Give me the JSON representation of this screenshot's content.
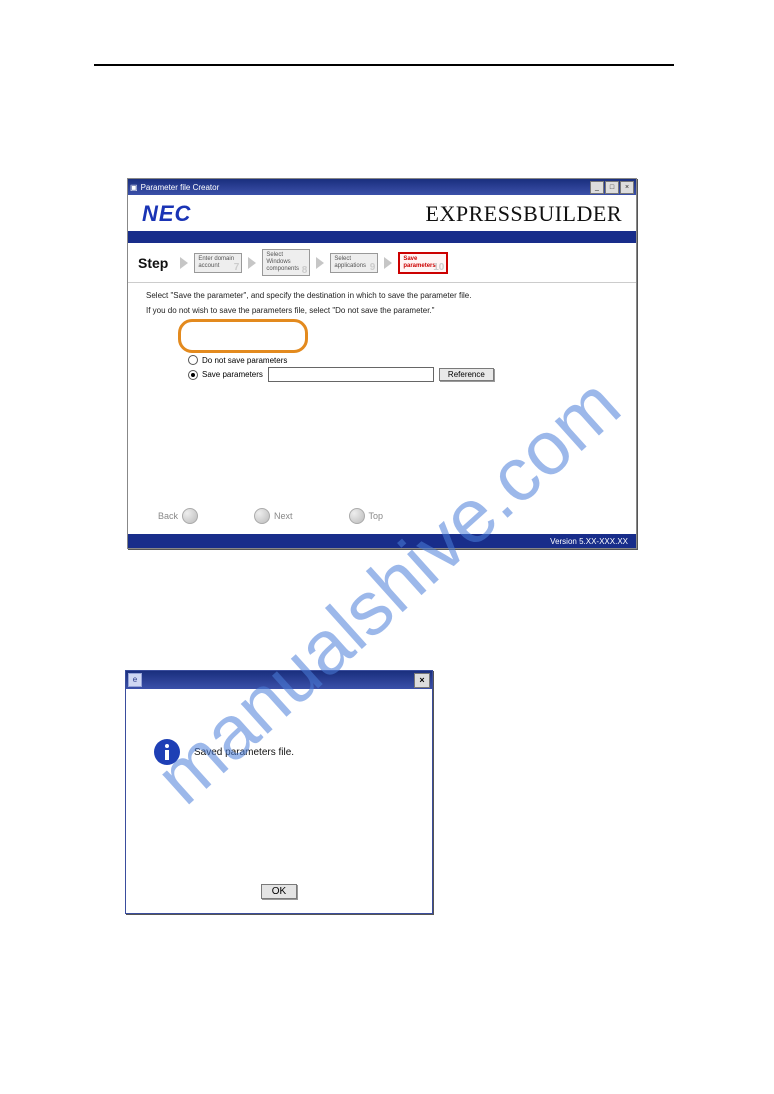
{
  "watermark_text": "manualshive.com",
  "window1": {
    "title": "Parameter file Creator",
    "brand_logo_text": "NEC",
    "product_title": "EXPRESSBUILDER",
    "step_label": "Step",
    "steps": {
      "s7": {
        "text": "Enter domain account",
        "num": "7"
      },
      "s8": {
        "text": "Select Windows components",
        "num": "8"
      },
      "s9": {
        "text": "Select applications",
        "num": "9"
      },
      "s10": {
        "text": "Save parameters",
        "num": "10"
      }
    },
    "instruction_line1": "Select \"Save the parameter\", and specify the destination in which to save the parameter file.",
    "instruction_line2": "If you do not wish to save the parameters file, select \"Do not save the parameter.\"",
    "option_do_not_save": "Do not save parameters",
    "option_save": "Save parameters",
    "path_value": "",
    "reference_button": "Reference",
    "nav_back": "Back",
    "nav_next": "Next",
    "nav_top": "Top",
    "version": "Version 5.XX-XXX.XX"
  },
  "dialog2": {
    "message": "Saved parameters file.",
    "ok_label": "OK"
  }
}
